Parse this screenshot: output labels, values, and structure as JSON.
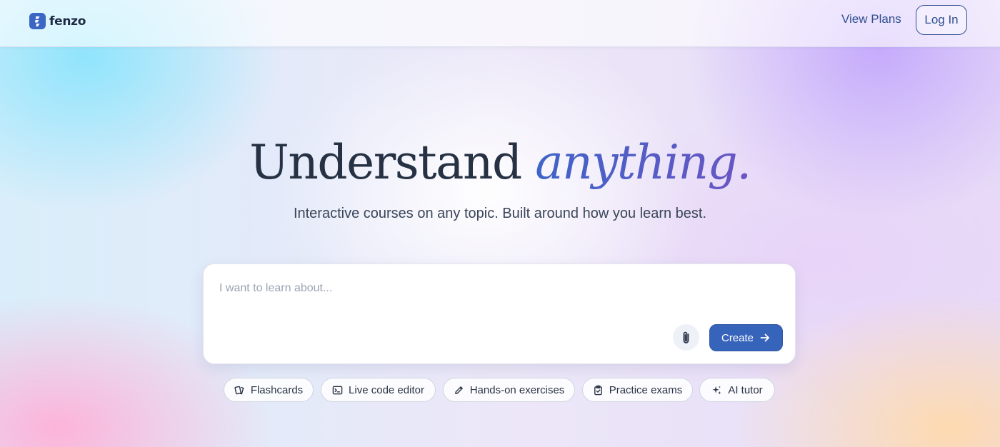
{
  "brand": {
    "name": "fenzo",
    "logo_icon": "fenzo-logo-icon",
    "color": "#3b66c4"
  },
  "nav": {
    "view_plans_label": "View Plans",
    "login_label": "Log In"
  },
  "hero": {
    "title_main": "Understand",
    "title_accent": "anything.",
    "subtitle": "Interactive courses on any topic. Built around how you learn best."
  },
  "prompt": {
    "placeholder": "I want to learn about...",
    "value": "",
    "attach_icon": "paperclip-icon",
    "create_label": "Create",
    "create_icon": "arrow-right-icon"
  },
  "features": [
    {
      "label": "Flashcards",
      "icon": "flashcards-icon"
    },
    {
      "label": "Live code editor",
      "icon": "terminal-icon"
    },
    {
      "label": "Hands-on exercises",
      "icon": "pencil-icon"
    },
    {
      "label": "Practice exams",
      "icon": "clipboard-check-icon"
    },
    {
      "label": "AI tutor",
      "icon": "sparkles-icon"
    }
  ],
  "colors": {
    "accent": "#3764bb",
    "text_dark": "#263244",
    "link": "#2f4f8f"
  }
}
